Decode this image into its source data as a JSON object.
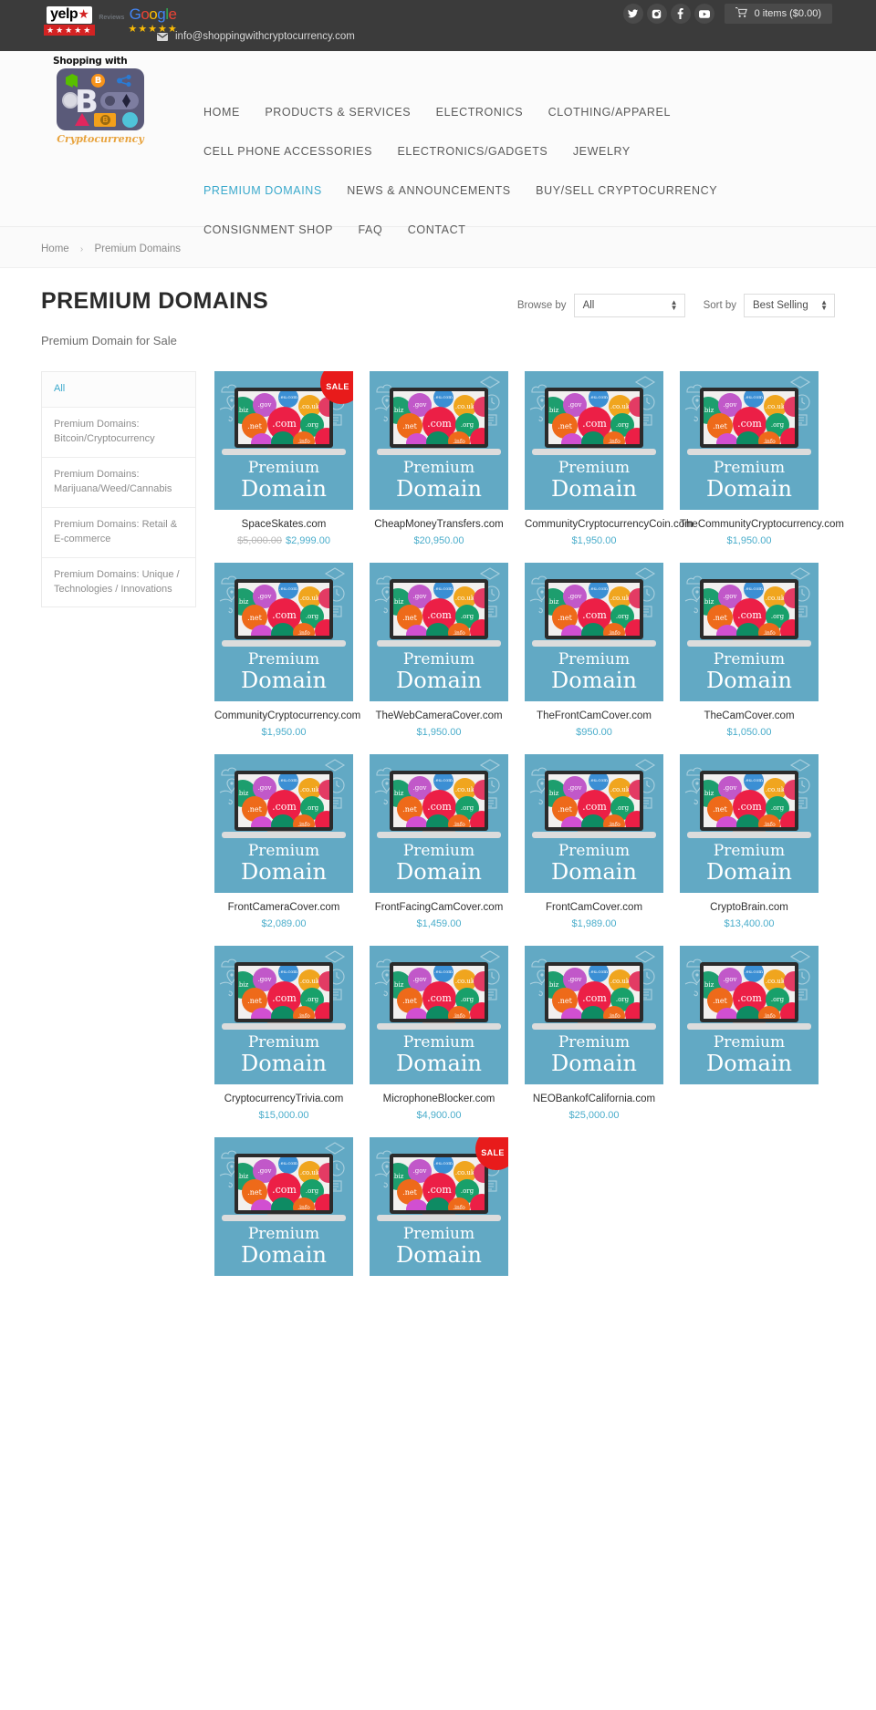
{
  "topbar": {
    "yelp": {
      "name": "yelp",
      "stars": "★★★★★"
    },
    "reviews_word": "Reviews",
    "google": {
      "letters": [
        "G",
        "o",
        "o",
        "g",
        "l",
        "e"
      ],
      "stars": "★★★★★"
    },
    "email": "info@shoppingwithcryptocurrency.com",
    "email_icon": "envelope-icon",
    "social": [
      {
        "name": "twitter-icon",
        "glyph": "twitter"
      },
      {
        "name": "instagram-icon",
        "glyph": "instagram"
      },
      {
        "name": "facebook-icon",
        "glyph": "f"
      },
      {
        "name": "youtube-icon",
        "glyph": "youtube"
      }
    ],
    "cart": {
      "icon": "cart-icon",
      "label": "0 items ($0.00)"
    }
  },
  "logo": {
    "top_text": "Shopping with",
    "bottom_text": "Cryptocurrency",
    "bitcoin_symbol": "B",
    "small_btc": "B",
    "note_symbol": "B"
  },
  "nav": {
    "rows": [
      [
        {
          "label": "HOME",
          "active": false,
          "name": "nav-home"
        },
        {
          "label": "PRODUCTS & SERVICES",
          "active": false,
          "name": "nav-products-services"
        },
        {
          "label": "ELECTRONICS",
          "active": false,
          "name": "nav-electronics"
        },
        {
          "label": "CLOTHING/APPAREL",
          "active": false,
          "name": "nav-clothing-apparel"
        }
      ],
      [
        {
          "label": "CELL PHONE ACCESSORIES",
          "active": false,
          "name": "nav-cell-phone-accessories"
        },
        {
          "label": "ELECTRONICS/GADGETS",
          "active": false,
          "name": "nav-electronics-gadgets"
        },
        {
          "label": "JEWELRY",
          "active": false,
          "name": "nav-jewelry"
        }
      ],
      [
        {
          "label": "PREMIUM DOMAINS",
          "active": true,
          "name": "nav-premium-domains"
        },
        {
          "label": "NEWS & ANNOUNCEMENTS",
          "active": false,
          "name": "nav-news-announcements"
        },
        {
          "label": "BUY/SELL CRYPTOCURRENCY",
          "active": false,
          "name": "nav-buy-sell-cryptocurrency"
        }
      ],
      [
        {
          "label": "CONSIGNMENT SHOP",
          "active": false,
          "name": "nav-consignment-shop"
        },
        {
          "label": "FAQ",
          "active": false,
          "name": "nav-faq"
        },
        {
          "label": "CONTACT",
          "active": false,
          "name": "nav-contact"
        }
      ]
    ]
  },
  "breadcrumb": {
    "home": "Home",
    "separator": "›",
    "current": "Premium Domains"
  },
  "page": {
    "title": "PREMIUM DOMAINS",
    "subtitle": "Premium Domain for Sale"
  },
  "filters": {
    "browse_label": "Browse by",
    "browse_value": "All",
    "sort_label": "Sort by",
    "sort_value": "Best Selling"
  },
  "sidebar": {
    "items": [
      {
        "label": "All",
        "active": true
      },
      {
        "label": "Premium Domains: Bitcoin/Cryptocurrency",
        "active": false
      },
      {
        "label": "Premium Domains: Marijuana/Weed/Cannabis",
        "active": false
      },
      {
        "label": "Premium Domains: Retail & E-commerce",
        "active": false
      },
      {
        "label": "Premium Domains: Unique / Technologies / Innovations",
        "active": false
      }
    ]
  },
  "product_image": {
    "premium": "Premium",
    "domain": "Domain",
    "sale_label": "SALE",
    "bubbles": [
      {
        "text": ".biz",
        "cls": "b-green1"
      },
      {
        "text": ".gov",
        "cls": "b-purple"
      },
      {
        "text": ".eu.com",
        "cls": "b-blue"
      },
      {
        "text": ".co.uk",
        "cls": "b-orange2"
      },
      {
        "text": "",
        "cls": "b-pinkr"
      },
      {
        "text": ".com",
        "cls": "b-red"
      },
      {
        "text": ".net",
        "cls": "b-orange"
      },
      {
        "text": ".org",
        "cls": "b-green2"
      },
      {
        "text": "",
        "cls": "b-mag"
      },
      {
        "text": "",
        "cls": "b-teal"
      },
      {
        "text": ".info",
        "cls": "b-ora3"
      },
      {
        "text": "",
        "cls": "b-red2"
      }
    ]
  },
  "products": [
    {
      "name": "SpaceSkates.com",
      "price": "$2,999.00",
      "compare_at": "$5,000.00",
      "sale": true
    },
    {
      "name": "CheapMoneyTransfers.com",
      "price": "$20,950.00",
      "compare_at": null,
      "sale": false
    },
    {
      "name": "CommunityCryptocurrencyCoin.com",
      "price": "$1,950.00",
      "compare_at": null,
      "sale": false
    },
    {
      "name": "TheCommunityCryptocurrency.com",
      "price": "$1,950.00",
      "compare_at": null,
      "sale": false
    },
    {
      "name": "CommunityCryptocurrency.com",
      "price": "$1,950.00",
      "compare_at": null,
      "sale": false
    },
    {
      "name": "TheWebCameraCover.com",
      "price": "$1,950.00",
      "compare_at": null,
      "sale": false
    },
    {
      "name": "TheFrontCamCover.com",
      "price": "$950.00",
      "compare_at": null,
      "sale": false
    },
    {
      "name": "TheCamCover.com",
      "price": "$1,050.00",
      "compare_at": null,
      "sale": false
    },
    {
      "name": "FrontCameraCover.com",
      "price": "$2,089.00",
      "compare_at": null,
      "sale": false
    },
    {
      "name": "FrontFacingCamCover.com",
      "price": "$1,459.00",
      "compare_at": null,
      "sale": false
    },
    {
      "name": "FrontCamCover.com",
      "price": "$1,989.00",
      "compare_at": null,
      "sale": false
    },
    {
      "name": "CryptoBrain.com",
      "price": "$13,400.00",
      "compare_at": null,
      "sale": false
    },
    {
      "name": "CryptocurrencyTrivia.com",
      "price": "$15,000.00",
      "compare_at": null,
      "sale": false
    },
    {
      "name": "MicrophoneBlocker.com",
      "price": "$4,900.00",
      "compare_at": null,
      "sale": false
    },
    {
      "name": "NEOBankofCalifornia.com",
      "price": "$25,000.00",
      "compare_at": null,
      "sale": false
    },
    {
      "name": "",
      "price": "",
      "compare_at": null,
      "sale": false
    },
    {
      "name": "",
      "price": "",
      "compare_at": null,
      "sale": false
    },
    {
      "name": "",
      "price": "",
      "compare_at": null,
      "sale": true
    }
  ],
  "colors": {
    "accent": "#3aa9cc",
    "price": "#4aadcb",
    "sale": "#e81b1b",
    "topbar_bg": "#3b3b3b",
    "card_bg": "#62a9c4"
  }
}
